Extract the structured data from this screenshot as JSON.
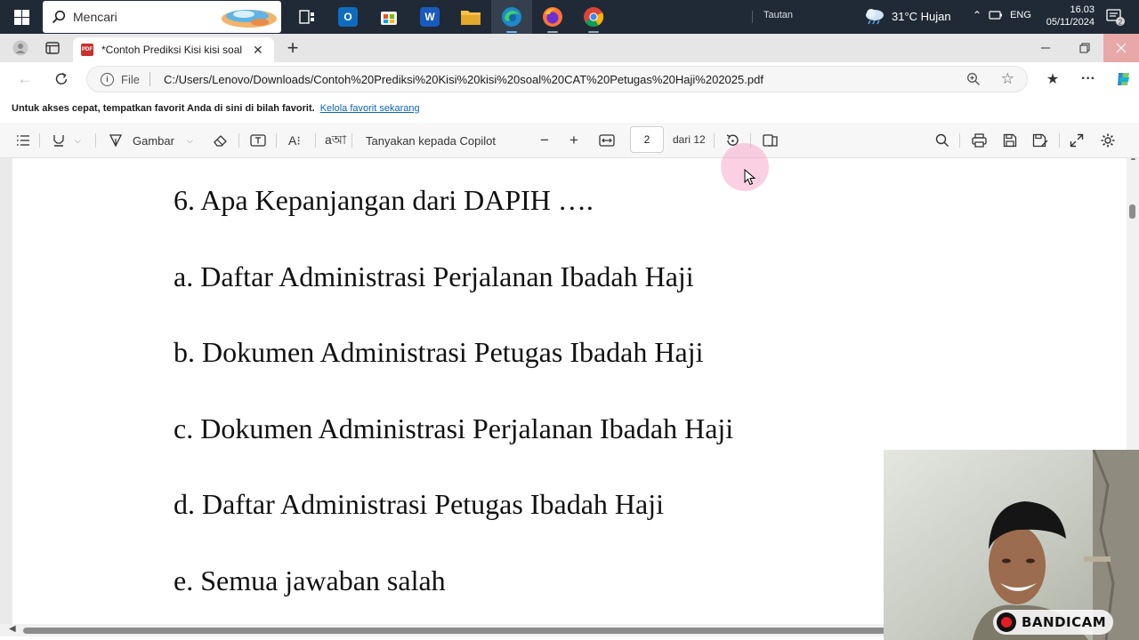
{
  "taskbar": {
    "search_label": "Mencari",
    "tautan_label": "Tautan",
    "weather": "31°C  Hujan",
    "language": "ENG",
    "time": "16.03",
    "date": "05/11/2024",
    "notification_count": "2",
    "apps": [
      "outlook-icon",
      "store-icon",
      "word-icon",
      "file-explorer-icon",
      "edge-icon",
      "firefox-icon",
      "chrome-icon"
    ]
  },
  "browser": {
    "tab_title": "*Contoh Prediksi Kisi kisi soal CAT",
    "address_scheme": "File",
    "address_url": "C:/Users/Lenovo/Downloads/Contoh%20Prediksi%20Kisi%20kisi%20soal%20CAT%20Petugas%20Haji%202025.pdf",
    "favorites_message": "Untuk akses cepat, tempatkan favorit Anda di sini di bilah favorit.",
    "favorites_link": "Kelola favorit sekarang"
  },
  "pdf_toolbar": {
    "draw_label": "Gambar",
    "copilot_label": "Tanyakan kepada Copilot",
    "page_current": "2",
    "page_total": "dari 12"
  },
  "document": {
    "question": "6. Apa Kepanjangan dari DAPIH ….",
    "options": [
      "a. Daftar Administrasi Perjalanan Ibadah Haji",
      "b. Dokumen Administrasi Petugas Ibadah Haji",
      "c. Dokumen Administrasi Perjalanan Ibadah Haji",
      "d. Daftar Administrasi Petugas Ibadah Haji",
      "e. Semua jawaban salah"
    ]
  },
  "overlay": {
    "recorder_brand": "BANDICAM"
  },
  "colors": {
    "taskbar_bg": "#1f2a36",
    "link": "#0b65b6",
    "cursor_highlight": "#f796be",
    "pdf_icon": "#c8312d"
  }
}
